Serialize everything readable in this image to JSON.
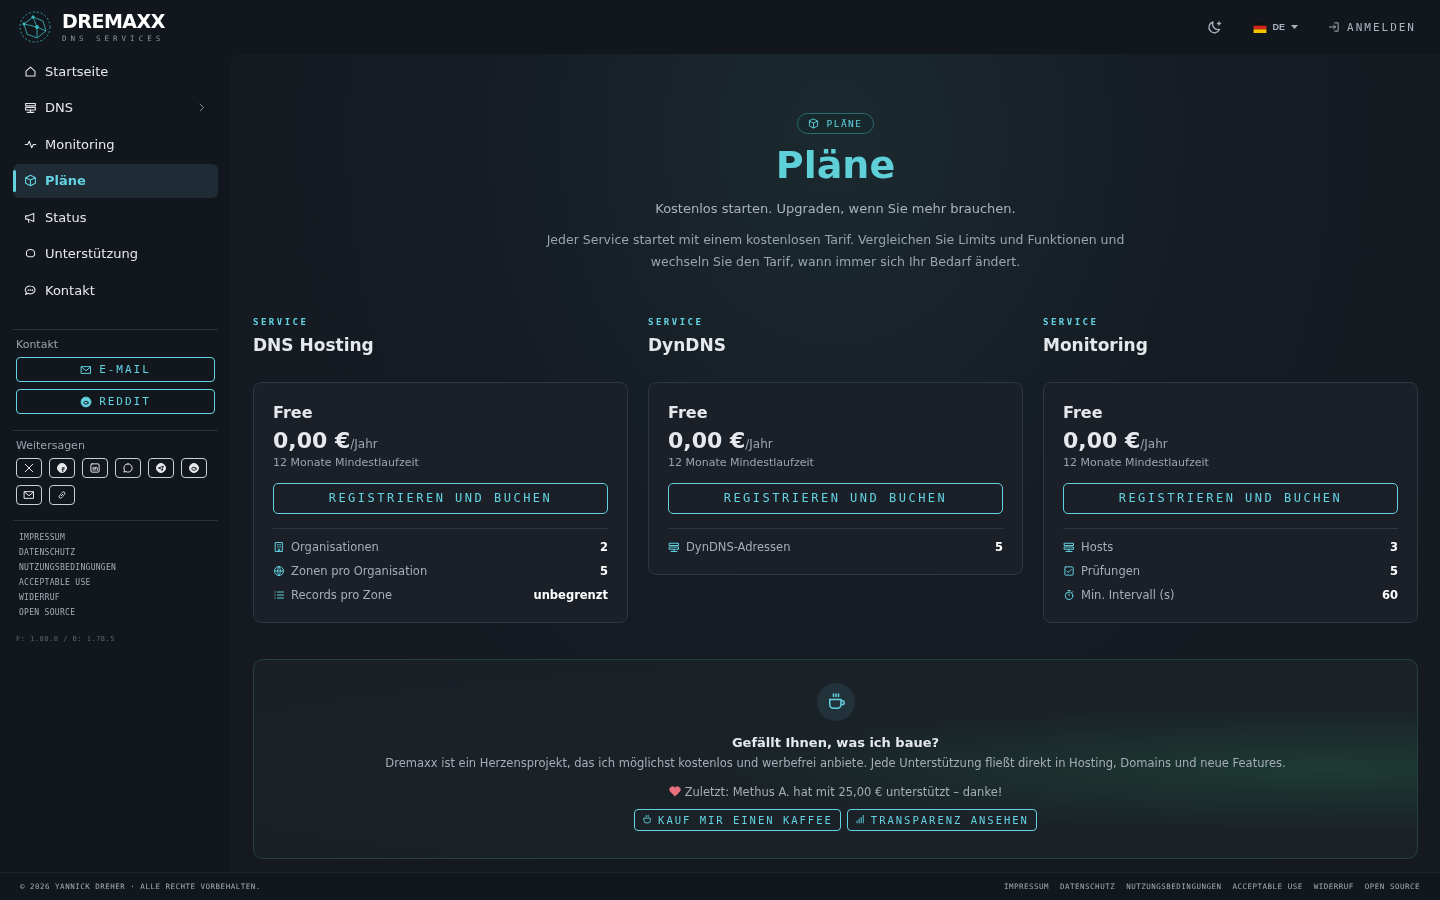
{
  "header": {
    "brand": "DREMAXX",
    "tagline": "DNS SERVICES",
    "language": "DE",
    "login": "ANMELDEN"
  },
  "sidebar": {
    "nav": [
      {
        "label": "Startseite",
        "selected": false,
        "submenu": false
      },
      {
        "label": "DNS",
        "selected": false,
        "submenu": true
      },
      {
        "label": "Monitoring",
        "selected": false,
        "submenu": false
      },
      {
        "label": "Pläne",
        "selected": true,
        "submenu": false
      },
      {
        "label": "Status",
        "selected": false,
        "submenu": false
      },
      {
        "label": "Unterstützung",
        "selected": false,
        "submenu": false
      },
      {
        "label": "Kontakt",
        "selected": false,
        "submenu": false
      }
    ],
    "contact": {
      "heading": "Kontakt",
      "buttons": [
        "E-MAIL",
        "REDDIT"
      ]
    },
    "share": {
      "heading": "Weitersagen"
    },
    "legal_links": [
      "IMPRESSUM",
      "DATENSCHUTZ",
      "NUTZUNGSBEDINGUNGEN",
      "ACCEPTABLE USE",
      "WIDERRUF",
      "OPEN SOURCE"
    ],
    "version": "F: 1.88.8 / B: 1.78.5"
  },
  "hero": {
    "badge": "PLÄNE",
    "title": "Pläne",
    "subtitle": "Kostenlos starten. Upgraden, wenn Sie mehr brauchen.",
    "description": "Jeder Service startet mit einem kostenlosen Tarif. Vergleichen Sie Limits und Funktionen und wechseln Sie den Tarif, wann immer sich Ihr Bedarf ändert."
  },
  "services": [
    {
      "eyebrow": "SERVICE",
      "name": "DNS Hosting",
      "plan": {
        "name": "Free",
        "price": "0,00 €",
        "period": "/Jahr",
        "term": "12 Monate Mindestlaufzeit",
        "button": "REGISTRIEREN UND BUCHEN",
        "features": [
          {
            "label": "Organisationen",
            "value": "2"
          },
          {
            "label": "Zonen pro Organisation",
            "value": "5"
          },
          {
            "label": "Records pro Zone",
            "value": "unbegrenzt"
          }
        ]
      }
    },
    {
      "eyebrow": "SERVICE",
      "name": "DynDNS",
      "plan": {
        "name": "Free",
        "price": "0,00 €",
        "period": "/Jahr",
        "term": "12 Monate Mindestlaufzeit",
        "button": "REGISTRIEREN UND BUCHEN",
        "features": [
          {
            "label": "DynDNS-Adressen",
            "value": "5"
          }
        ]
      }
    },
    {
      "eyebrow": "SERVICE",
      "name": "Monitoring",
      "plan": {
        "name": "Free",
        "price": "0,00 €",
        "period": "/Jahr",
        "term": "12 Monate Mindestlaufzeit",
        "button": "REGISTRIEREN UND BUCHEN",
        "features": [
          {
            "label": "Hosts",
            "value": "3"
          },
          {
            "label": "Prüfungen",
            "value": "5"
          },
          {
            "label": "Min. Intervall (s)",
            "value": "60"
          }
        ]
      }
    }
  ],
  "support": {
    "title": "Gefällt Ihnen, was ich baue?",
    "text": "Dremaxx ist ein Herzensprojekt, das ich möglichst kostenlos und werbefrei anbiete. Jede Unterstützung fließt direkt in Hosting, Domains und neue Features.",
    "recent": "Zuletzt: Methus A. hat mit 25,00 € unterstützt – danke!",
    "buttons": [
      "KAUF MIR EINEN KAFFEE",
      "TRANSPARENZ ANSEHEN"
    ]
  },
  "footer": {
    "copyright": "© 2026 YANNICK DREHER · ALLE RECHTE VORBEHALTEN.",
    "links": [
      "IMPRESSUM",
      "DATENSCHUTZ",
      "NUTZUNGSBEDINGUNGEN",
      "ACCEPTABLE USE",
      "WIDERRUF",
      "OPEN SOURCE"
    ]
  }
}
